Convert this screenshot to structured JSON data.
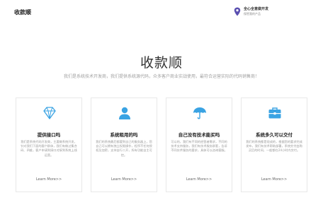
{
  "header": {
    "logo": "收款顺",
    "location_title": "全心全意做开发",
    "location_sub": "保密我的产品"
  },
  "hero": {
    "title": "收款顺",
    "description": "我们是系统技术开发商，我们提供系统源代码，众多客户商业实战使用，最符合运营实际的代码销售商！"
  },
  "cards": [
    {
      "icon": "diamond-icon",
      "title": "提供接口吗",
      "text": "我们是系统代码开发商，主要做系统开发，针对我们下面的客户群体，我们有做过集合码、四维，客户申请到接口对接到系统上线运营。",
      "link": "Learn More>>"
    },
    {
      "icon": "user-icon",
      "title": "系统租用的吗",
      "text": "我们的系统最后都要到自己的服务器上，您自己可以拥有独立权限操作，程序不任何授权及加密，支持自行二开，所有功能自主可控。",
      "link": "Learn More>>"
    },
    {
      "icon": "umbrella-icon",
      "title": "自己没有技术能买吗",
      "text": "可以的，我们有不同的经营者需求，不同的技术支持服务，我们有技术服务群套，告诉不同技术服务的要求，具体可以咨询客服。",
      "link": "Learn More>>"
    },
    {
      "icon": "briefcase-icon",
      "title": "系统多久可以交付",
      "text": "我们的系统都是现成的，根据您的要求完成发布，我们有技术帮助部署，系统交付由购买后的时间，一般都在24小时内交付。",
      "link": "Learn More>>"
    }
  ],
  "colors": {
    "accent": "#3aa3e3",
    "text": "#333333",
    "muted": "#999999"
  }
}
